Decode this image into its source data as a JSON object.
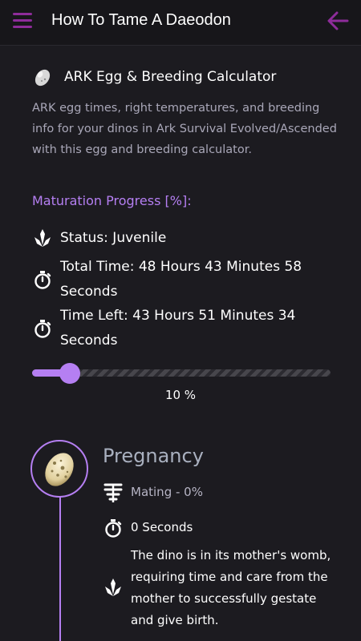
{
  "app": {
    "title": "How To Tame A Daeodon",
    "accent_color": "#8e2c9a",
    "highlight_color": "#b57ff2",
    "menu_icon": "hamburger-menu-icon",
    "back_icon": "arrow-left-icon"
  },
  "card": {
    "title": "ARK Egg & Breeding Calculator",
    "icon": "egg-icon",
    "description": "ARK egg times, right temperatures, and breeding info for your dinos in Ark Survival Evolved/Ascended with this egg and breeding calculator."
  },
  "maturation": {
    "label": "Maturation Progress [%]:",
    "status": "Status: Juvenile",
    "total_time_label": "Total Time:",
    "total_time_value": "48 Hours 43 Minutes 58 Seconds",
    "time_left_label": "Time Left:",
    "time_left_value": "43 Hours 51 Minutes 34 Seconds",
    "progress_fraction": 0.1,
    "progress_text": "10 %"
  },
  "timeline": {
    "stage_title": "Pregnancy",
    "mating": "Mating - 0%",
    "duration": "0 Seconds",
    "description": "The dino is in its mother's womb, requiring time and care from the mother to successfully gestate and give birth."
  }
}
